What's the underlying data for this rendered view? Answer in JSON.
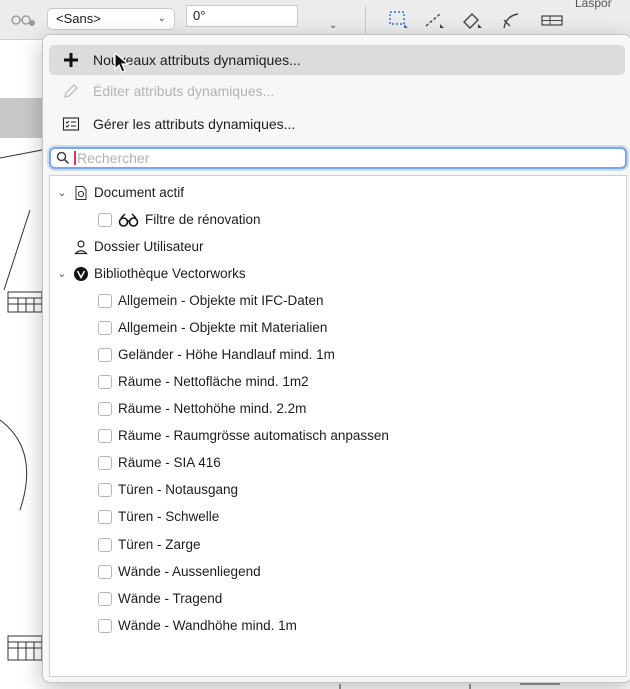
{
  "toolbar": {
    "class_select": "<Sans>",
    "angle_value": "0°",
    "right_label": "Laspor"
  },
  "menu": {
    "new_label": "Nouveaux attributs dynamiques...",
    "edit_label": "Éditer attributs dynamiques...",
    "manage_label": "Gérer les attributs dynamiques..."
  },
  "search": {
    "placeholder": "Rechercher",
    "value": ""
  },
  "tree": {
    "document": {
      "label": "Document actif",
      "children": [
        "Filtre de rénovation"
      ]
    },
    "user_folder": "Dossier Utilisateur",
    "library": {
      "label": "Bibliothèque Vectorworks",
      "items": [
        "Allgemein - Objekte mit IFC-Daten",
        "Allgemein - Objekte mit Materialien",
        "Geländer - Höhe Handlauf mind. 1m",
        "Räume - Nettofläche mind. 1m2",
        "Räume - Nettohöhe mind. 2.2m",
        "Räume - Raumgrösse automatisch anpassen",
        "Räume - SIA 416",
        "Türen - Notausgang",
        "Türen - Schwelle",
        "Türen - Zarge",
        "Wände - Aussenliegend",
        "Wände - Tragend",
        "Wände - Wandhöhe mind. 1m"
      ]
    }
  },
  "colors": {
    "accent": "#7aa7e8",
    "hover": "#dcdcdc",
    "disabled": "#b3b3b3",
    "caret": "#d6336c"
  }
}
